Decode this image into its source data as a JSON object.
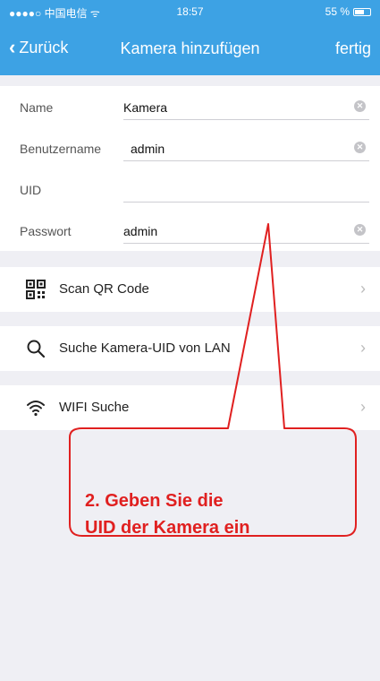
{
  "status_bar": {
    "carrier": "●●●●○ 中国电信 ᯤ",
    "time": "18:57",
    "battery": "55 %"
  },
  "nav": {
    "back_label": "Zurück",
    "title": "Kamera hinzufügen",
    "done_label": "fertig"
  },
  "form": {
    "name_label": "Name",
    "name_value": "Kamera",
    "username_label": "Benutzername",
    "username_value": "admin",
    "uid_label": "UID",
    "uid_value": "",
    "password_label": "Passwort",
    "password_value": "admin"
  },
  "menu": {
    "scan_qr": "Scan QR Code",
    "search_lan": "Suche Kamera-UID von LAN",
    "wifi_search": "WIFI Suche"
  },
  "annotation": {
    "line1": "2. Geben Sie die",
    "line2": "UID der Kamera ein",
    "color": "#e02020"
  },
  "colors": {
    "nav_bar": "#3da2e4",
    "background": "#efeff4"
  }
}
